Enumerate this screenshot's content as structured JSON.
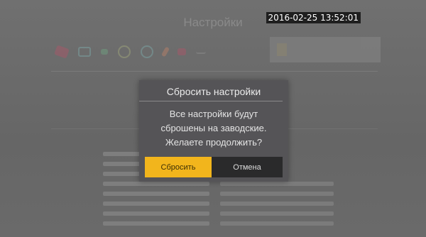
{
  "background": {
    "screen_title": "Настройки",
    "colors": {
      "screen_bg": "#6b6b6b"
    }
  },
  "timestamp": "2016-02-25 13:52:01",
  "dialog": {
    "title": "Сбросить настройки",
    "message_lines": [
      "Все настройки будут",
      "сброшены на заводские.",
      "Желаете продолжить?"
    ],
    "buttons": {
      "confirm": "Сбросить",
      "cancel": "Отмена"
    },
    "colors": {
      "dialog_bg": "#555457",
      "confirm_bg": "#f2b51c",
      "cancel_bg": "#2a2a2b"
    }
  }
}
